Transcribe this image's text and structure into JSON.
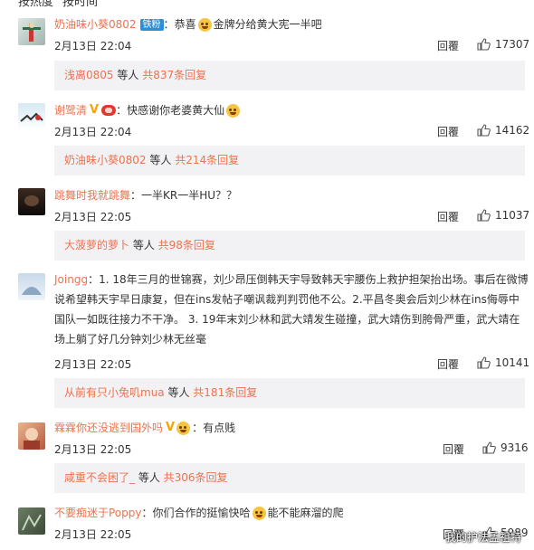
{
  "sort": {
    "hot": "按热度",
    "time": "按时间"
  },
  "comments": [
    {
      "user": "奶油味小葵0802",
      "badge": "铁粉",
      "text_before": "恭喜",
      "text_after": "金牌分给黄大宪一半吧",
      "date": "2月13日 22:04",
      "reply": "回覆",
      "likes": "17307",
      "sub": {
        "user": "浅离0805",
        "mid": " 等人 ",
        "count": "共837条回复"
      }
    },
    {
      "user": "谢鹭清",
      "text": "快感谢你老婆黄大仙",
      "date": "2月13日 22:04",
      "reply": "回覆",
      "likes": "14162",
      "sub": {
        "user": "奶油味小葵0802",
        "mid": " 等人 ",
        "count": "共214条回复"
      }
    },
    {
      "user": "跳舞时我就跳舞",
      "text": "一半KR一半HU？？",
      "date": "2月13日 22:05",
      "reply": "回覆",
      "likes": "11037",
      "sub": {
        "user": "大菠萝的萝卜",
        "mid": " 等人 ",
        "count": "共98条回复"
      }
    },
    {
      "user": "Joingg",
      "lines": [
        "1. 18年三月的世锦赛，刘少昂压倒韩天宇导致韩天宇腰伤上救护担架抬出场。事后在微博",
        "说希望韩天宇早日康复，但在ins发帖子嘲讽裁判判罚他不公。2.平昌冬奥会后刘少林在ins侮辱中",
        "国队一如既往接力不干净。 3. 19年末刘少林和武大靖发生碰撞，武大靖伤到胯骨严重，武大靖在",
        "场上躺了好几分钟刘少林无丝毫"
      ],
      "date": "2月13日 22:05",
      "reply": "回覆",
      "likes": "10141",
      "sub": {
        "user": "从前有只小兔叽mua",
        "mid": " 等人 ",
        "count": "共181条回复"
      }
    },
    {
      "user": "霖霖你还没逃到国外吗",
      "text": "有点贱",
      "date": "2月13日 22:05",
      "reply": "回覆",
      "likes": "9316",
      "sub": {
        "user": "咸重不会困了_",
        "mid": " 等人 ",
        "count": "共306条回复"
      }
    },
    {
      "user": "不要痴迷于Poppy",
      "text_before": "你们合作的挺愉快哈",
      "text_after": "能不能麻溜的爬",
      "date": "2月13日 22:05",
      "reply": "回覆",
      "likes": "5989"
    }
  ],
  "watermark": "我的护法孟祖特",
  "colors": {
    "username": "#eb7350",
    "sub_bg": "#f2f2f5",
    "v_badge": "#f7a300"
  },
  "icons": {
    "like": "thumbs-up-icon",
    "vip": "v-badge-icon",
    "emoji": "emoji-icon"
  }
}
